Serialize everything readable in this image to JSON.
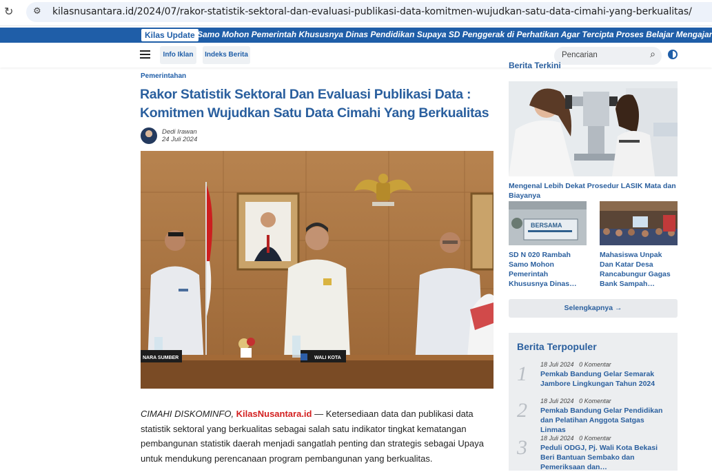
{
  "browser": {
    "url": "kilasnusantara.id/2024/07/rakor-statistik-sektoral-dan-evaluasi-publikasi-data-komitmen-wujudkan-satu-data-cimahi-yang-berkualitas/"
  },
  "ticker": {
    "badge": "Kilas Update",
    "text": "Samo Mohon Pemerintah Khususnya Dinas Pendidikan Supaya SD Penggerak di Perhatikan Agar Tercipta Proses Belajar Mengajar Yan"
  },
  "nav": {
    "items": [
      {
        "label": "Info Iklan"
      },
      {
        "label": "Indeks Berita"
      }
    ],
    "search_placeholder": "Pencarian"
  },
  "article": {
    "category": "Pemerintahan",
    "title": "Rakor Statistik Sektoral Dan Evaluasi Publikasi Data : Komitmen Wujudkan Satu Data Cimahi Yang Berkualitas",
    "author": "Dedi Irawan",
    "date": "24 Juli 2024",
    "dateline": "CIMAHI DISKOMINFO, ",
    "brand": "KilasNusantara.id",
    "body": " — Ketersediaan data dan publikasi data statistik sektoral yang berkualitas sebagai salah satu indikator tingkat kematangan pembangunan statistik daerah menjadi sangatlah penting dan strategis sebagai Upaya untuk mendukung perencanaan program pembangunan yang berkualitas.",
    "nameplates": [
      "NARA SUMBER",
      "WALI KOTA"
    ]
  },
  "sidebar": {
    "heading_cut": "Berita Terkini",
    "featured_title": "Mengenal Lebih Dekat Prosedur LASIK Mata dan Biayanya",
    "small_items": [
      {
        "title": "SD N 020 Rambah Samo Mohon Pemerintah Khususnya Dinas…",
        "sign": "BERSAMA"
      },
      {
        "title": "Mahasiswa Unpak Dan Katar Desa Rancabungur Gagas Bank Sampah…"
      }
    ],
    "more_label": "Selengkapnya →",
    "popular_heading": "Berita Terpopuler",
    "popular": [
      {
        "num": "1",
        "date": "18 Juli 2024",
        "comments": "0 Komentar",
        "title": "Pemkab Bandung Gelar Semarak Jambore Lingkungan Tahun 2024"
      },
      {
        "num": "2",
        "date": "18 Juli 2024",
        "comments": "0 Komentar",
        "title": "Pemkab Bandung Gelar Pendidikan dan Pelatihan Anggota Satgas Linmas"
      },
      {
        "num": "3",
        "date": "18 Juli 2024",
        "comments": "0 Komentar",
        "title": "Peduli ODGJ, Pj. Wali Kota Bekasi Beri Bantuan Sembako dan Pemeriksaan dan…"
      }
    ]
  },
  "colors": {
    "accent": "#1f5ea8",
    "title": "#2a5f9e",
    "brand_red": "#d32020"
  }
}
